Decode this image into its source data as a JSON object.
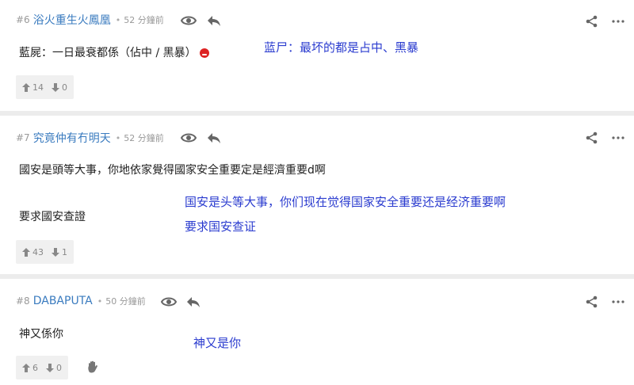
{
  "posts": [
    {
      "num": "#6",
      "user": "浴火重生火鳳凰",
      "time": "52 分鐘前",
      "lines": [
        "藍屍：一日最衰都係（佔中 / 黑暴）"
      ],
      "translation": [
        "蓝尸：最坏的都是占中、黑暴"
      ],
      "up": "14",
      "down": "0"
    },
    {
      "num": "#7",
      "user": "究竟仲有冇明天",
      "time": "52 分鐘前",
      "lines": [
        "國安是頭等大事，你地依家覺得國家安全重要定是經濟重要d啊",
        "要求國安查證"
      ],
      "translation": [
        "国安是头等大事，你们现在觉得国家安全重要还是经济重要啊",
        "要求国安查证"
      ],
      "up": "43",
      "down": "1"
    },
    {
      "num": "#8",
      "user": "DABAPUTA",
      "time": "50 分鐘前",
      "lines": [
        "神又係你"
      ],
      "translation": [
        "神又是你"
      ],
      "up": "6",
      "down": "0"
    }
  ],
  "icons": {
    "view": "eye-icon",
    "reply": "reply-icon",
    "share": "share-icon",
    "more": "more-icon",
    "upvote": "arrow-up-icon",
    "downvote": "arrow-down-icon",
    "emoji": "angry-face-icon",
    "hand": "hand-icon"
  },
  "colors": {
    "username": "#3a7bbf",
    "translation": "#2a3bcf"
  }
}
